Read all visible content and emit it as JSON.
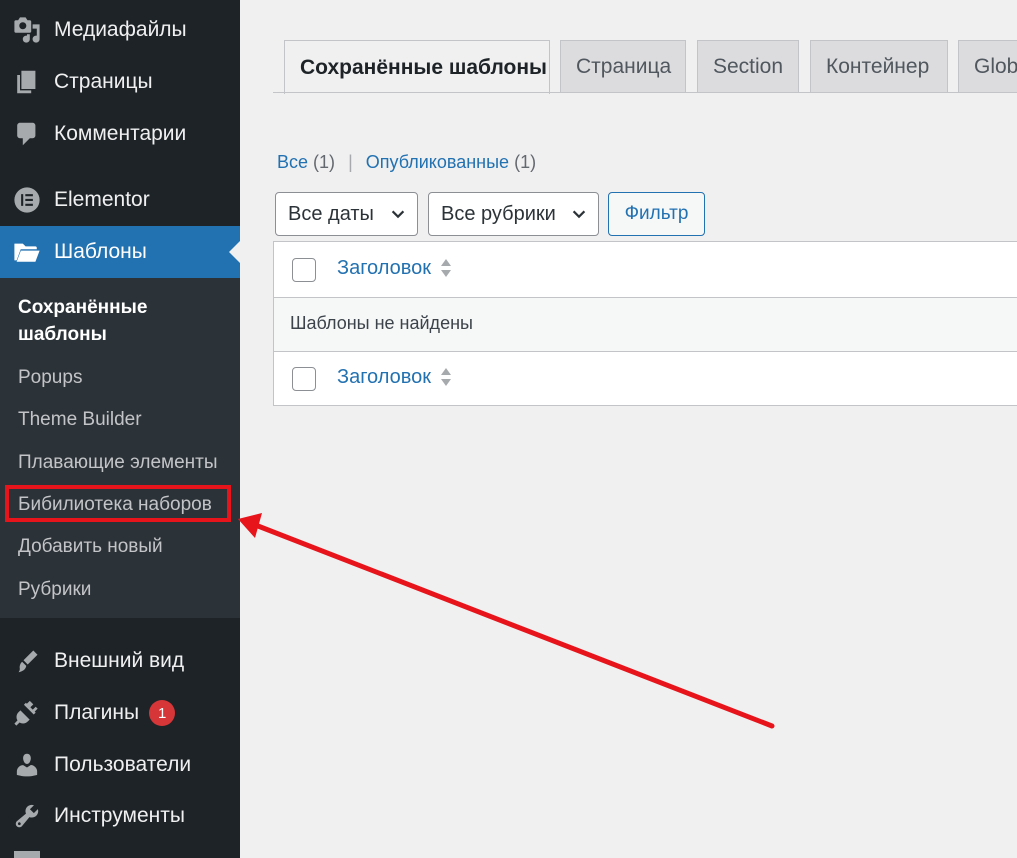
{
  "sidebar": {
    "menu": [
      {
        "label": "Медиафайлы",
        "icon": "media-icon"
      },
      {
        "label": "Страницы",
        "icon": "pages-icon"
      },
      {
        "label": "Комментарии",
        "icon": "comments-icon"
      },
      {
        "label": "Elementor",
        "icon": "elementor-icon"
      },
      {
        "label": "Шаблоны",
        "icon": "folder-open-icon"
      }
    ],
    "submenu": [
      "Сохранённые шаблоны",
      "Popups",
      "Theme Builder",
      "Плавающие элементы",
      "Бибилиотека наборов",
      "Добавить новый",
      "Рубрики"
    ],
    "menu_bottom": [
      {
        "label": "Внешний вид",
        "icon": "paintbrush-icon"
      },
      {
        "label": "Плагины",
        "icon": "plugin-icon",
        "badge": "1"
      },
      {
        "label": "Пользователи",
        "icon": "user-icon"
      },
      {
        "label": "Инструменты",
        "icon": "wrench-icon"
      }
    ]
  },
  "tabs": [
    "Сохранённые шаблоны",
    "Страница",
    "Section",
    "Контейнер",
    "Glob"
  ],
  "views": {
    "all_label": "Все",
    "all_count": "(1)",
    "separator": "|",
    "published_label": "Опубликованные",
    "published_count": "(1)"
  },
  "filters": {
    "dates": "Все даты",
    "categories": "Все рубрики",
    "filter_button": "Фильтр"
  },
  "table": {
    "column_title": "Заголовок",
    "empty_message": "Шаблоны не найдены"
  },
  "colors": {
    "sidebar_bg": "#1d2327",
    "submenu_bg": "#2c3338",
    "accent": "#2271b1",
    "annotation": "#e8141b",
    "badge": "#d63638"
  }
}
